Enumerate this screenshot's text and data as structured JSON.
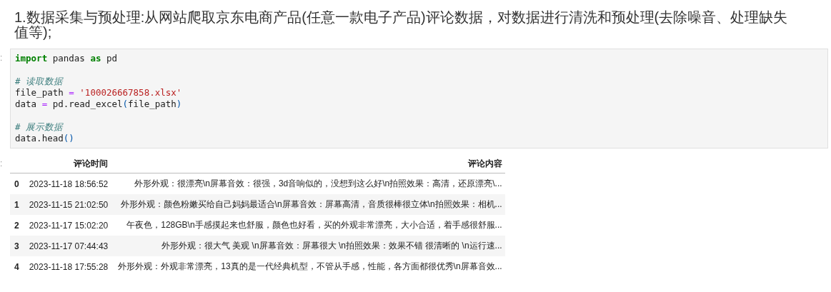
{
  "heading": "1.数据采集与预处理:从网站爬取京东电商产品(任意一款电子产品)评论数据，对数据进行清洗和预处理(去除噪音、处理缺失值等);",
  "code_cell": {
    "prompt": ":",
    "blocks": [
      {
        "lines": [
          {
            "tokens": [
              {
                "kind": "keyword",
                "text": "import"
              },
              {
                "kind": "plain",
                "text": " pandas "
              },
              {
                "kind": "keyword",
                "text": "as"
              },
              {
                "kind": "plain",
                "text": " pd"
              }
            ]
          }
        ]
      },
      {
        "lines": [
          {
            "tokens": [
              {
                "kind": "comment",
                "text": "# 读取数据"
              }
            ]
          },
          {
            "tokens": [
              {
                "kind": "plain",
                "text": "file_path "
              },
              {
                "kind": "operator",
                "text": "= "
              },
              {
                "kind": "string",
                "text": "'100026667858.xlsx'"
              }
            ]
          },
          {
            "tokens": [
              {
                "kind": "plain",
                "text": "data "
              },
              {
                "kind": "operator",
                "text": "= "
              },
              {
                "kind": "plain",
                "text": "pd.read_excel"
              },
              {
                "kind": "paren",
                "text": "("
              },
              {
                "kind": "plain",
                "text": "file_path"
              },
              {
                "kind": "paren",
                "text": ")"
              }
            ]
          }
        ]
      },
      {
        "lines": [
          {
            "tokens": [
              {
                "kind": "comment",
                "text": "# 展示数据"
              }
            ]
          },
          {
            "tokens": [
              {
                "kind": "plain",
                "text": "data.head"
              },
              {
                "kind": "paren",
                "text": "()"
              }
            ]
          }
        ]
      }
    ]
  },
  "output": {
    "prompt": ":",
    "columns": [
      "评论时间",
      "评论内容"
    ],
    "rows": [
      {
        "index": "0",
        "time": "2023-11-18 18:56:52",
        "content": "外形外观：很漂亮\\n屏幕音效：很强，3d音响似的，没想到这么好\\n拍照效果：高清，还原漂亮\\..."
      },
      {
        "index": "1",
        "time": "2023-11-15 21:02:50",
        "content": "外形外观：颜色粉嫩买给自己妈妈最适合\\n屏幕音效：屏幕高清，音质很棒很立体\\n拍照效果：相机..."
      },
      {
        "index": "2",
        "time": "2023-11-17 15:02:20",
        "content": "午夜色，128GB\\n手感摸起来也舒服，颜色也好看，买的外观非常漂亮，大小合适，着手感很舒服..."
      },
      {
        "index": "3",
        "time": "2023-11-17 07:44:43",
        "content": "外形外观：很大气 美观 \\n屏幕音效：屏幕很大 \\n拍照效果：效果不错 很清晰的 \\n运行速..."
      },
      {
        "index": "4",
        "time": "2023-11-18 17:55:28",
        "content": "外形外观：外观非常漂亮，13真的是一代经典机型，不管从手感，性能，各方面都很优秀\\n屏幕音效..."
      }
    ]
  }
}
